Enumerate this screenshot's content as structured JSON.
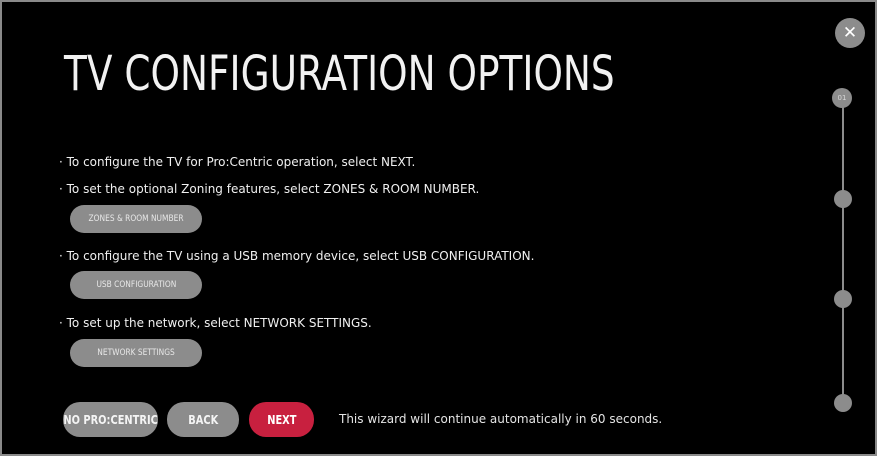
{
  "title": "TV CONFIGURATION OPTIONS",
  "close_label": "✕",
  "instructions": {
    "next": "· To configure the TV for Pro:Centric operation, select NEXT.",
    "zones": "· To set the optional Zoning features, select ZONES & ROOM NUMBER.",
    "usb": "· To configure the TV using a USB memory device, select USB CONFIGURATION.",
    "network": "· To set up the network, select NETWORK SETTINGS."
  },
  "options": {
    "zones_button": "ZONES & ROOM NUMBER",
    "usb_button": "USB CONFIGURATION",
    "network_button": "NETWORK SETTINGS"
  },
  "footer": {
    "no_procentric_button": "NO PRO:CENTRIC",
    "back_button": "BACK",
    "next_button": "NEXT",
    "countdown_text": "This wizard will continue automatically in 60 seconds."
  },
  "stepper": {
    "current_step": "01",
    "total_steps": 4
  },
  "colors": {
    "background": "#000000",
    "button_gray": "#8c8c8c",
    "accent_red": "#c8203f"
  }
}
